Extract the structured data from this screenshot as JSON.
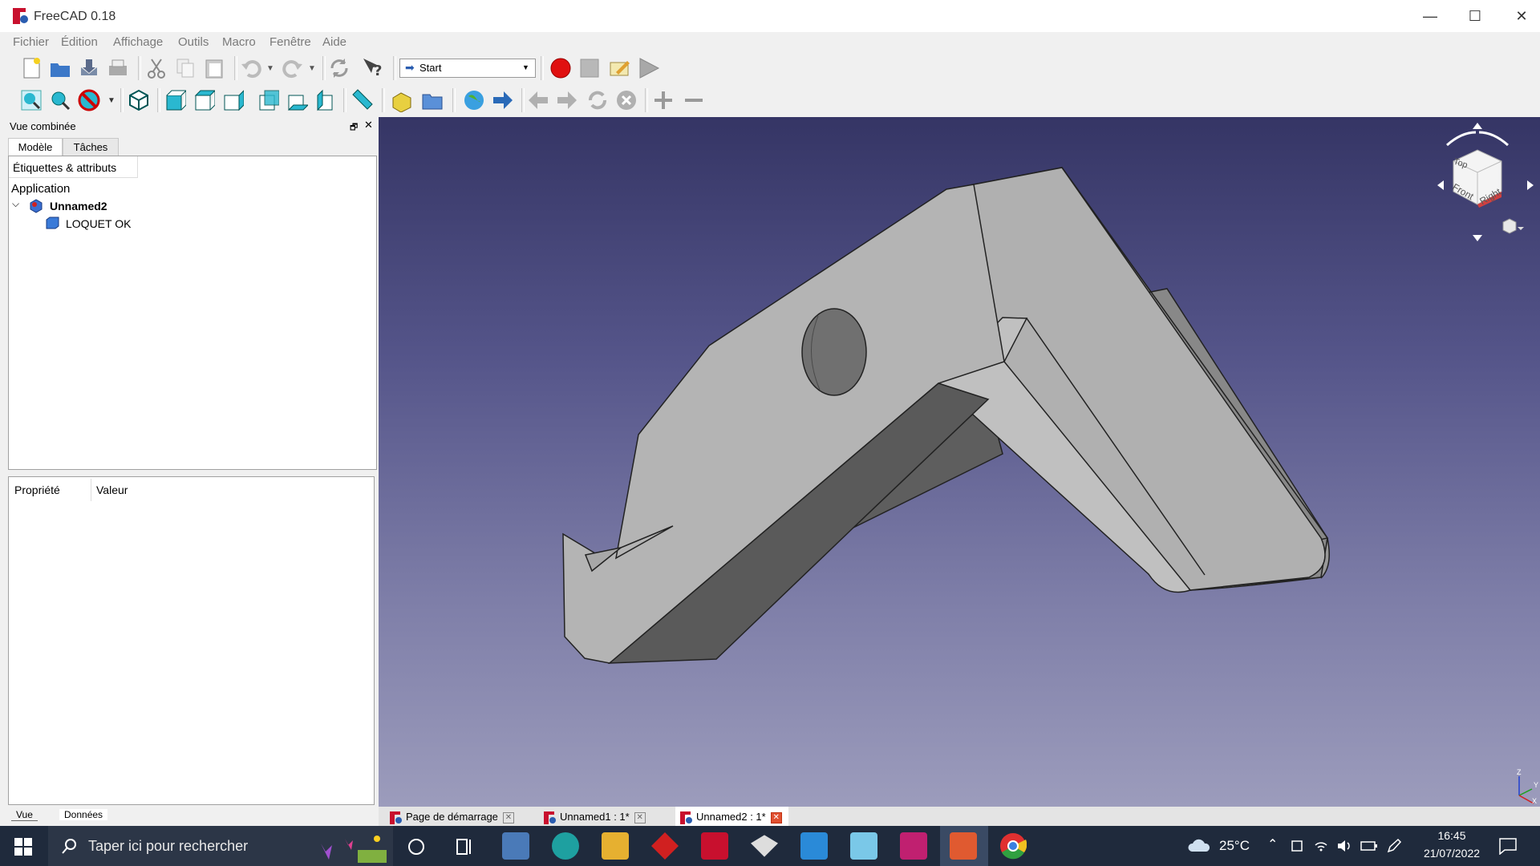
{
  "window": {
    "title": "FreeCAD 0.18",
    "min": "—",
    "max": "☐",
    "close": "✕"
  },
  "menu": [
    "Fichier",
    "Édition",
    "Affichage",
    "Outils",
    "Macro",
    "Fenêtre",
    "Aide"
  ],
  "toolbar": {
    "workbench": "Start"
  },
  "combo": {
    "title": "Vue combinée",
    "tabs": [
      "Modèle",
      "Tâches"
    ],
    "tree_header": "Étiquettes & attributs",
    "app_label": "Application",
    "doc_name": "Unnamed2",
    "object_name": "LOQUET OK",
    "prop_header": [
      "Propriété",
      "Valeur"
    ],
    "bottom_tabs": [
      "Vue",
      "Données"
    ]
  },
  "navcube": {
    "top": "Top",
    "front": "Front",
    "right": "Right"
  },
  "axis": {
    "z": "Z",
    "y": "Y",
    "x": "X"
  },
  "doc_tabs": [
    "Page de démarrage",
    "Unnamed1 : 1*",
    "Unnamed2 : 1*"
  ],
  "taskbar": {
    "search_placeholder": "Taper ici pour rechercher",
    "weather": "25°C",
    "time": "16:45",
    "date": "21/07/2022"
  },
  "colors": {
    "accent_record": "#e01010",
    "viewport_top": "#353565",
    "viewport_bottom": "#9c9cbc"
  }
}
